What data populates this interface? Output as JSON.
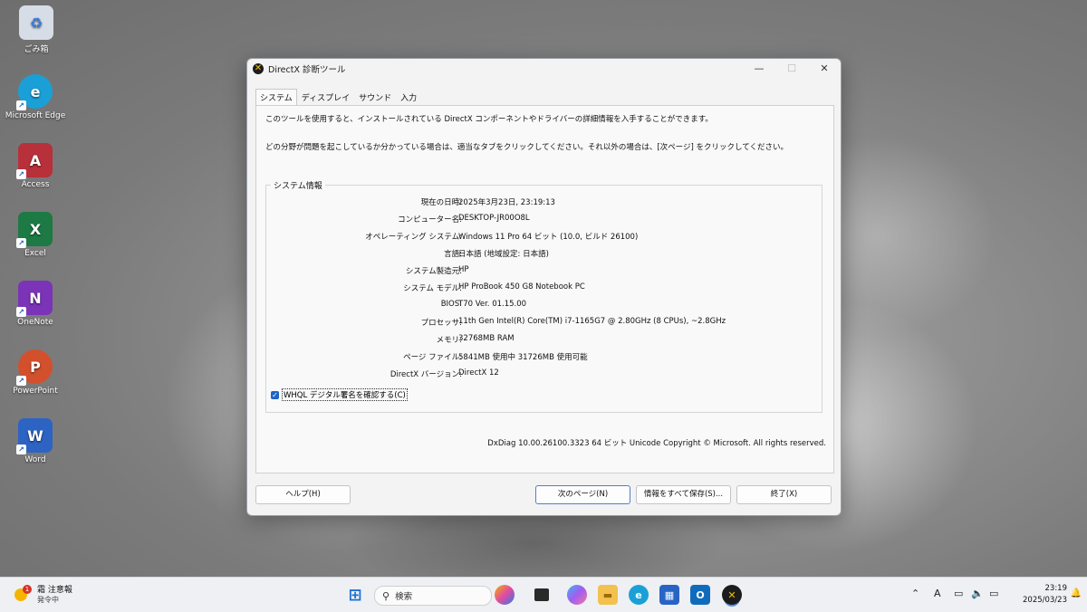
{
  "desktop": {
    "icons": [
      {
        "label": "ごみ箱",
        "color": "#d7dde6"
      },
      {
        "label": "Microsoft Edge",
        "color": "#1aa0d6"
      },
      {
        "label": "Access",
        "color": "#b7303a"
      },
      {
        "label": "Excel",
        "color": "#1d7a44"
      },
      {
        "label": "OneNote",
        "color": "#7b33b7"
      },
      {
        "label": "PowerPoint",
        "color": "#d2502c"
      },
      {
        "label": "Word",
        "color": "#2d63c3"
      }
    ]
  },
  "window": {
    "title": "DirectX 診断ツール",
    "controls": {
      "minimize": "—",
      "maximize": "☐",
      "close": "✕"
    },
    "tabs": [
      "システム",
      "ディスプレイ",
      "サウンド",
      "入力"
    ],
    "intro1": "このツールを使用すると、インストールされている DirectX コンポーネントやドライバーの詳細情報を入手することができます。",
    "intro2": "どの分野が問題を起こしているか分かっている場合は、適当なタブをクリックしてください。それ以外の場合は、[次ページ] をクリックしてください。",
    "group_title": "システム情報",
    "rows": [
      {
        "label": "現在の日時:",
        "value": "2025年3月23日, 23:19:13"
      },
      {
        "label": "コンピューター名:",
        "value": "DESKTOP-JR00O8L"
      },
      {
        "label": "オペレーティング システム:",
        "value": "Windows 11 Pro 64 ビット (10.0, ビルド 26100)"
      },
      {
        "label": "言語:",
        "value": "日本語 (地域設定: 日本語)"
      },
      {
        "label": "システム製造元:",
        "value": "HP"
      },
      {
        "label": "システム モデル:",
        "value": "HP ProBook 450 G8 Notebook PC"
      },
      {
        "label": "BIOS:",
        "value": "T70 Ver. 01.15.00"
      },
      {
        "label": "プロセッサ:",
        "value": "11th Gen Intel(R) Core(TM) i7-1165G7 @ 2.80GHz (8 CPUs), ~2.8GHz"
      },
      {
        "label": "メモリ:",
        "value": "32768MB RAM"
      },
      {
        "label": "ページ ファイル:",
        "value": "5841MB 使用中 31726MB 使用可能"
      },
      {
        "label": "DirectX バージョン:",
        "value": "DirectX 12"
      }
    ],
    "whql_label": "WHQL デジタル署名を確認する(C)",
    "whql_checked": true,
    "footer": "DxDiag 10.00.26100.3323 64 ビット Unicode  Copyright © Microsoft. All rights reserved.",
    "buttons": {
      "help": "ヘルプ(H)",
      "next": "次のページ(N)",
      "save": "情報をすべて保存(S)...",
      "exit": "終了(X)"
    }
  },
  "taskbar": {
    "weather_title": "霜 注意報",
    "weather_sub": "発令中",
    "weather_badge": "1",
    "search_placeholder": "検索",
    "time": "23:19",
    "date": "2025/03/23",
    "ime": "A"
  }
}
